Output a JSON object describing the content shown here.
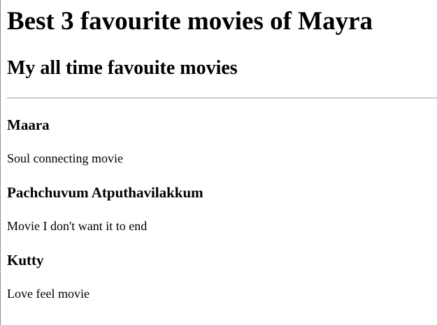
{
  "page": {
    "title": "Best 3 favourite movies of Mayra",
    "subtitle": "My all time favouite movies"
  },
  "movies": [
    {
      "name": "Maara",
      "description": "Soul connecting movie"
    },
    {
      "name": "Pachchuvum Atputhavilakkum",
      "description": "Movie I don't want it to end"
    },
    {
      "name": "Kutty",
      "description": "Love feel movie"
    }
  ]
}
